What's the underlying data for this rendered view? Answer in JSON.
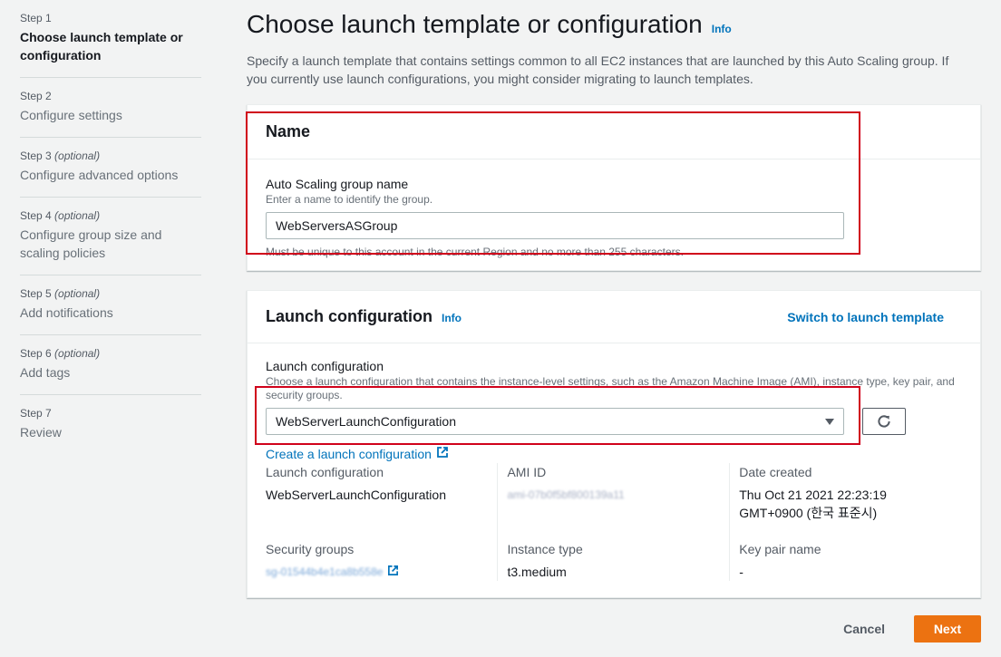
{
  "steps": [
    {
      "num": "Step 1",
      "optional": "",
      "title": "Choose launch template or configuration"
    },
    {
      "num": "Step 2",
      "optional": "",
      "title": "Configure settings"
    },
    {
      "num": "Step 3",
      "optional": "(optional)",
      "title": "Configure advanced options"
    },
    {
      "num": "Step 4",
      "optional": "(optional)",
      "title": "Configure group size and scaling policies"
    },
    {
      "num": "Step 5",
      "optional": "(optional)",
      "title": "Add notifications"
    },
    {
      "num": "Step 6",
      "optional": "(optional)",
      "title": "Add tags"
    },
    {
      "num": "Step 7",
      "optional": "",
      "title": "Review"
    }
  ],
  "page": {
    "title": "Choose launch template or configuration",
    "info": "Info",
    "description": "Specify a launch template that contains settings common to all EC2 instances that are launched by this Auto Scaling group. If you currently use launch configurations, you might consider migrating to launch templates."
  },
  "name_panel": {
    "title": "Name",
    "label": "Auto Scaling group name",
    "description": "Enter a name to identify the group.",
    "value": "WebServersASGroup",
    "constraint": "Must be unique to this account in the current Region and no more than 255 characters."
  },
  "lc_panel": {
    "title": "Launch configuration",
    "info": "Info",
    "switch_link": "Switch to launch template",
    "label": "Launch configuration",
    "description": "Choose a launch configuration that contains the instance-level settings, such as the Amazon Machine Image (AMI), instance type, key pair, and security groups.",
    "selected": "WebServerLaunchConfiguration",
    "create_link": "Create a launch configuration",
    "details": {
      "lc_label": "Launch configuration",
      "lc_value": "WebServerLaunchConfiguration",
      "ami_label": "AMI ID",
      "ami_value": "ami-07b0f5bf800139a11",
      "date_label": "Date created",
      "date_value": "Thu Oct 21 2021 22:23:19 GMT+0900 (한국 표준시)",
      "sg_label": "Security groups",
      "sg_value": "sg-01544b4e1ca8b558e",
      "type_label": "Instance type",
      "type_value": "t3.medium",
      "key_label": "Key pair name",
      "key_value": "-"
    }
  },
  "footer": {
    "cancel": "Cancel",
    "next": "Next"
  },
  "colors": {
    "accent": "#ec7211",
    "link": "#0073bb",
    "highlight": "#d0021b"
  }
}
